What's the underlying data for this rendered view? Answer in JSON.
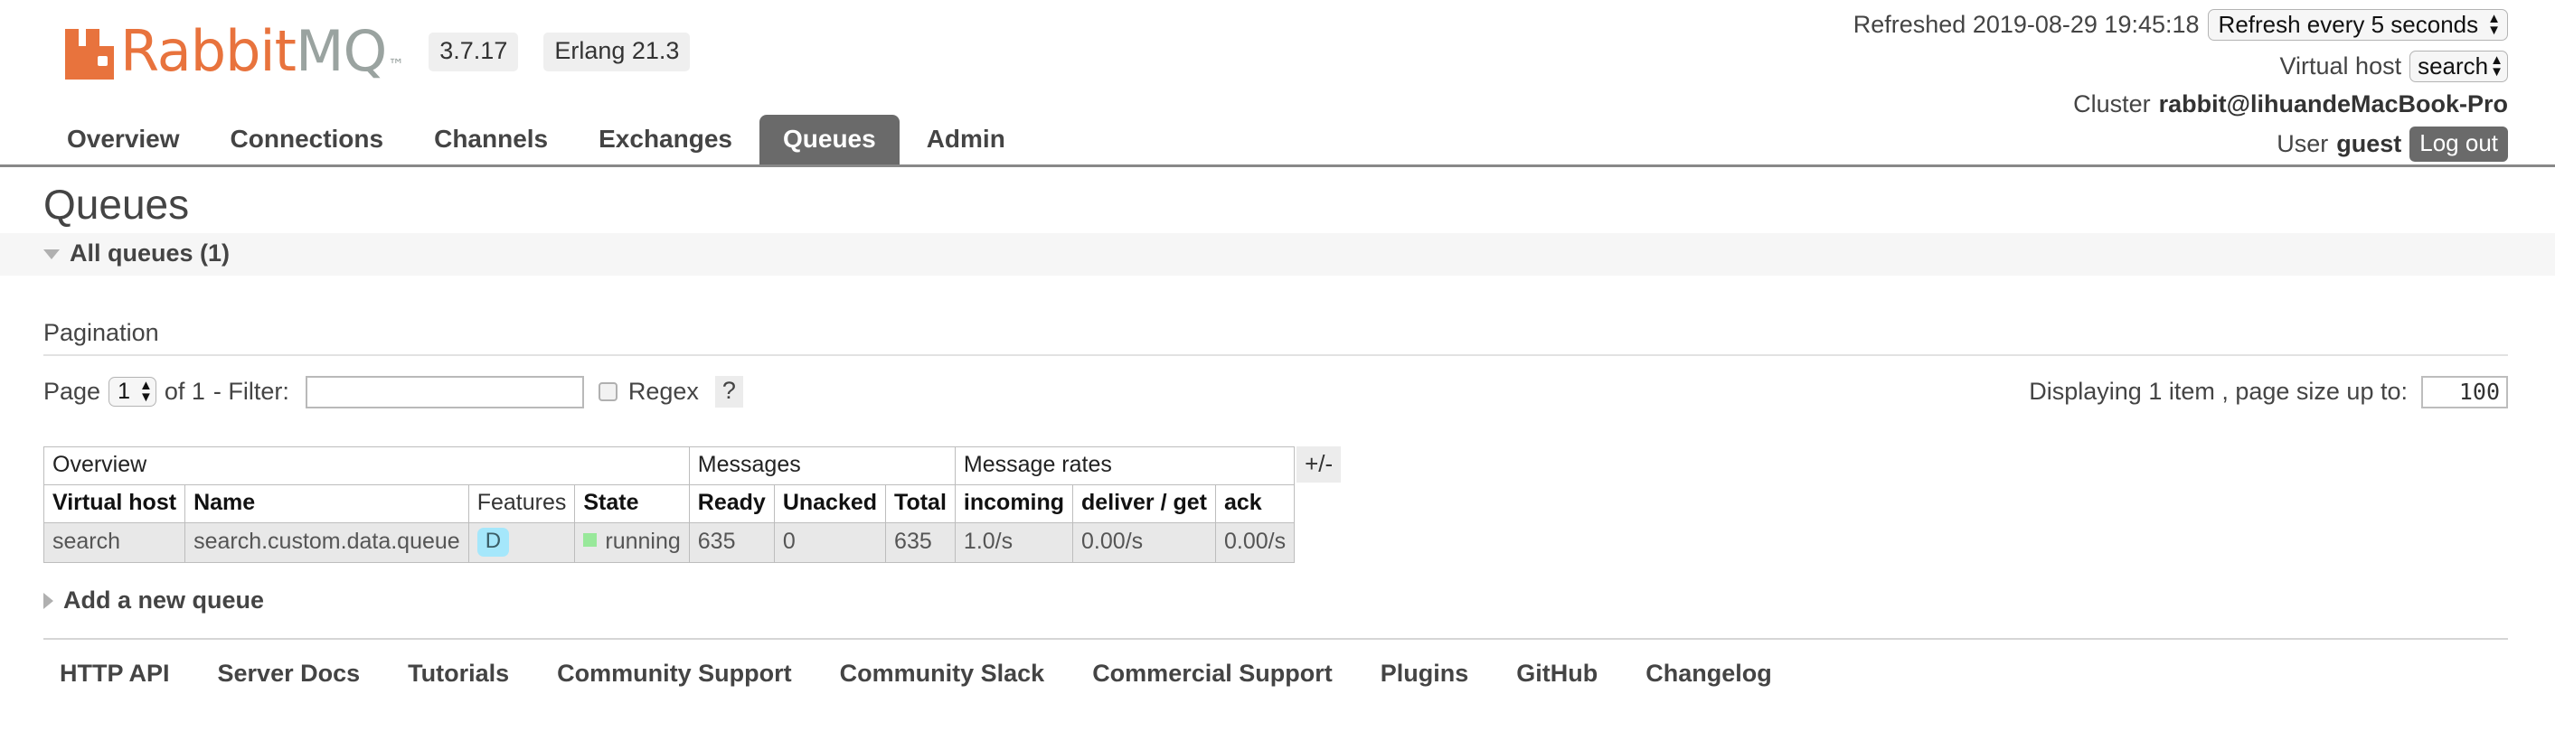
{
  "header": {
    "logo_rabbit": "Rabbit",
    "logo_mq": "MQ",
    "logo_tm": "™",
    "version": "3.7.17",
    "erlang": "Erlang 21.3",
    "refreshed_label": "Refreshed 2019-08-29 19:45:18",
    "refresh_select": "Refresh every 5 seconds",
    "vhost_label": "Virtual host",
    "vhost_select": "search",
    "cluster_label": "Cluster",
    "cluster_name": "rabbit@lihuandeMacBook-Pro",
    "user_label": "User",
    "user_name": "guest",
    "logout_label": "Log out"
  },
  "nav": {
    "items": [
      {
        "label": "Overview",
        "active": false
      },
      {
        "label": "Connections",
        "active": false
      },
      {
        "label": "Channels",
        "active": false
      },
      {
        "label": "Exchanges",
        "active": false
      },
      {
        "label": "Queues",
        "active": true
      },
      {
        "label": "Admin",
        "active": false
      }
    ]
  },
  "main": {
    "title": "Queues",
    "all_queues_label": "All queues (1)",
    "pagination_label": "Pagination",
    "page_label": "Page",
    "page_value": "1",
    "of_label": "of 1",
    "filter_label": "- Filter:",
    "filter_value": "",
    "filter_placeholder": "",
    "regex_label": "Regex",
    "help_label": "?",
    "displaying_label": "Displaying 1 item , page size up to:",
    "page_size_value": "100",
    "plusminus_label": "+/-",
    "add_queue_label": "Add a new queue"
  },
  "table": {
    "group_headers": [
      {
        "label": "Overview",
        "colspan": 4
      },
      {
        "label": "Messages",
        "colspan": 3
      },
      {
        "label": "Message rates",
        "colspan": 3
      }
    ],
    "columns": [
      {
        "label": "Virtual host",
        "bold": true,
        "align": "left"
      },
      {
        "label": "Name",
        "bold": true,
        "align": "left"
      },
      {
        "label": "Features",
        "bold": false,
        "align": "left"
      },
      {
        "label": "State",
        "bold": true,
        "align": "left"
      },
      {
        "label": "Ready",
        "bold": true,
        "align": "left"
      },
      {
        "label": "Unacked",
        "bold": true,
        "align": "left"
      },
      {
        "label": "Total",
        "bold": true,
        "align": "left"
      },
      {
        "label": "incoming",
        "bold": true,
        "align": "left"
      },
      {
        "label": "deliver / get",
        "bold": true,
        "align": "left"
      },
      {
        "label": "ack",
        "bold": true,
        "align": "left"
      }
    ],
    "rows": [
      {
        "vhost": "search",
        "name": "search.custom.data.queue",
        "features": "D",
        "state": "running",
        "ready": "635",
        "unacked": "0",
        "total": "635",
        "incoming": "1.0/s",
        "deliver_get": "0.00/s",
        "ack": "0.00/s"
      }
    ]
  },
  "footer": {
    "links": [
      "HTTP API",
      "Server Docs",
      "Tutorials",
      "Community Support",
      "Community Slack",
      "Commercial Support",
      "Plugins",
      "GitHub",
      "Changelog"
    ]
  },
  "colors": {
    "brand_orange": "#e8733d",
    "brand_gray": "#9aa3a0",
    "tab_active_bg": "#6a6a6a",
    "feature_badge_bg": "#a5e7fb",
    "state_running_dot": "#98e89a",
    "row_bg": "#e8e8e8",
    "section_bar_bg": "#f6f6f6"
  }
}
